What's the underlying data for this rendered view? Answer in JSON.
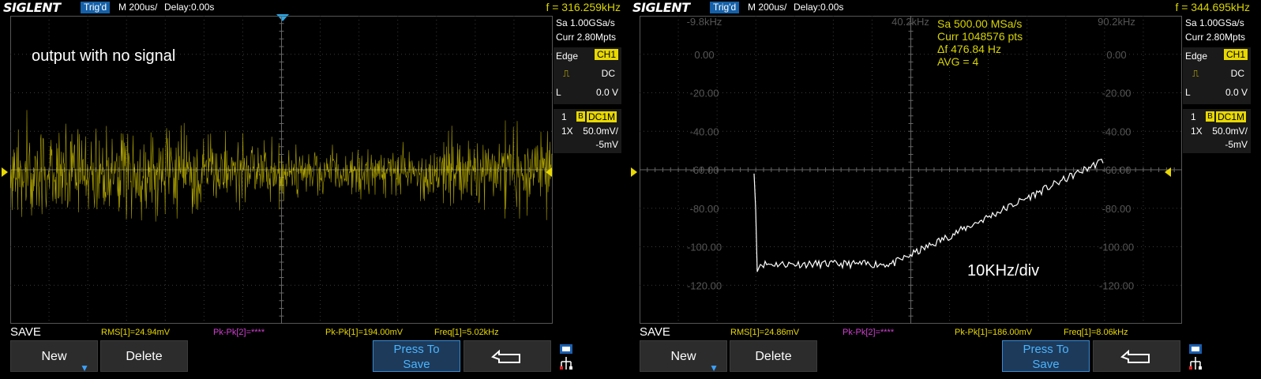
{
  "left": {
    "brand": "SIGLENT",
    "trig_status": "Trig'd",
    "timebase": "M 200us/",
    "delay": "Delay:0.00s",
    "frequency": "f = 316.259kHz",
    "annotation": "output with no signal",
    "side": {
      "sample_rate": "Sa 1.00GSa/s",
      "memory_depth": "Curr 2.80Mpts",
      "trigger_type": "Edge",
      "trigger_source": "CH1",
      "coupling": "DC",
      "level_label": "L",
      "level_value": "0.0 V",
      "channel_num": "1",
      "bw_tag": "B",
      "impedance": "DC1M",
      "probe": "1X",
      "volts_div": "50.0mV/",
      "offset": "-5mV"
    },
    "menu_title": "SAVE",
    "measurements": {
      "rms": "RMS[1]=24.94mV",
      "pkpk2": "Pk-Pk[2]=****",
      "pkpk1": "Pk-Pk[1]=194.00mV",
      "freq": "Freq[1]=5.02kHz"
    },
    "softkeys": {
      "new": "New",
      "delete": "Delete",
      "press_line1": "Press To",
      "press_line2": "Save"
    }
  },
  "right": {
    "brand": "SIGLENT",
    "trig_status": "Trig'd",
    "timebase": "M 200us/",
    "delay": "Delay:0.00s",
    "frequency": "f = 344.695kHz",
    "annotation": "10KHz/div",
    "fft_info": {
      "sample_rate": "Sa 500.00 MSa/s",
      "points": "Curr 1048576 pts",
      "delta_f": "Δf 476.84 Hz",
      "avg": "AVG = 4"
    },
    "freq_labels": [
      "-9.8kHz",
      "40.2kHz",
      "90.2kHz"
    ],
    "db_labels": [
      "0.00",
      "-20.00",
      "-40.00",
      "-60.00",
      "-80.00",
      "-100.00",
      "-120.00"
    ],
    "side": {
      "sample_rate": "Sa 1.00GSa/s",
      "memory_depth": "Curr 2.80Mpts",
      "trigger_type": "Edge",
      "trigger_source": "CH1",
      "coupling": "DC",
      "level_label": "L",
      "level_value": "0.0 V",
      "channel_num": "1",
      "bw_tag": "B",
      "impedance": "DC1M",
      "probe": "1X",
      "volts_div": "50.0mV/",
      "offset": "-5mV"
    },
    "menu_title": "SAVE",
    "measurements": {
      "rms": "RMS[1]=24.86mV",
      "pkpk2": "Pk-Pk[2]=****",
      "pkpk1": "Pk-Pk[1]=186.00mV",
      "freq": "Freq[1]=8.06kHz"
    },
    "softkeys": {
      "new": "New",
      "delete": "Delete",
      "press_line1": "Press To",
      "press_line2": "Save"
    }
  },
  "colors": {
    "ch1": "#e8d800",
    "math": "#d040d0",
    "accent": "#2aa8e8",
    "fft_trace": "#ffffff"
  }
}
